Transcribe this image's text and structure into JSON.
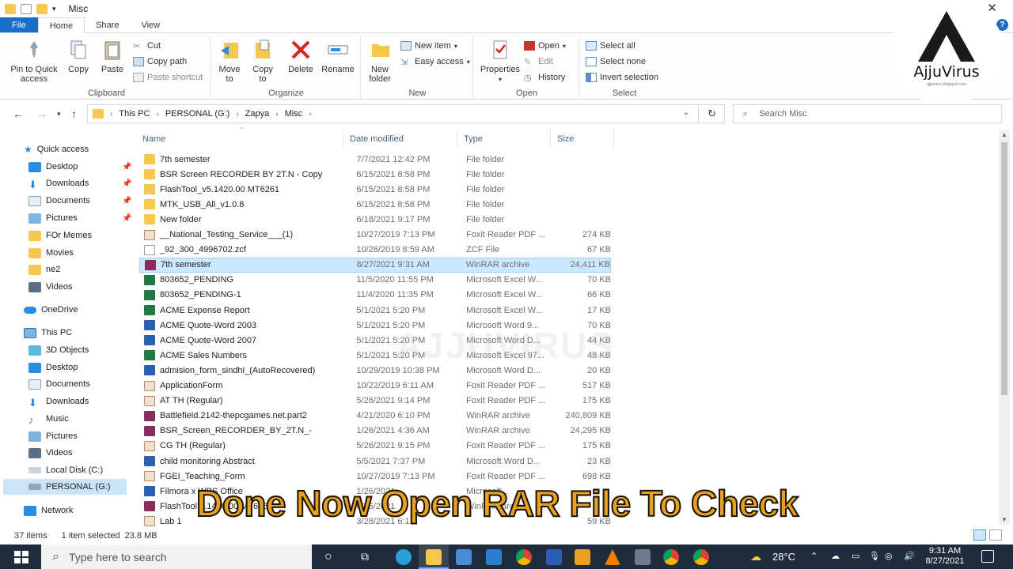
{
  "window": {
    "title": "Misc"
  },
  "ribbon_tabs": [
    "File",
    "Home",
    "Share",
    "View"
  ],
  "ribbon": {
    "clipboard": {
      "label": "Clipboard",
      "pin": "Pin to Quick access",
      "copy": "Copy",
      "paste": "Paste",
      "cut": "Cut",
      "copy_path": "Copy path",
      "paste_shortcut": "Paste shortcut"
    },
    "organize": {
      "label": "Organize",
      "move_to": "Move to",
      "copy_to": "Copy to",
      "delete": "Delete",
      "rename": "Rename"
    },
    "new": {
      "label": "New",
      "new_folder": "New folder",
      "new_item": "New item",
      "easy_access": "Easy access"
    },
    "open": {
      "label": "Open",
      "properties": "Properties",
      "open": "Open",
      "edit": "Edit",
      "history": "History"
    },
    "select": {
      "label": "Select",
      "select_all": "Select all",
      "select_none": "Select none",
      "invert": "Invert selection"
    }
  },
  "address": {
    "crumbs": [
      "This PC",
      "PERSONAL (G:)",
      "Zapya",
      "Misc"
    ],
    "search_placeholder": "Search Misc"
  },
  "nav": {
    "quick_access": "Quick access",
    "quick_items": [
      "Desktop",
      "Downloads",
      "Documents",
      "Pictures",
      "FOr Memes",
      "Movies",
      "ne2",
      "Videos"
    ],
    "onedrive": "OneDrive",
    "this_pc": "This PC",
    "pc_items": [
      "3D Objects",
      "Desktop",
      "Documents",
      "Downloads",
      "Music",
      "Pictures",
      "Videos",
      "Local Disk (C:)",
      "PERSONAL (G:)"
    ],
    "network": "Network"
  },
  "columns": {
    "name": "Name",
    "date": "Date modified",
    "type": "Type",
    "size": "Size"
  },
  "files": [
    {
      "name": "7th semester",
      "date": "7/7/2021 12:42 PM",
      "type": "File folder",
      "size": "",
      "icon": "folder"
    },
    {
      "name": "BSR Screen RECORDER BY 2T.N - Copy",
      "date": "6/15/2021 8:58 PM",
      "type": "File folder",
      "size": "",
      "icon": "folder"
    },
    {
      "name": "FlashTool_v5.1420.00 MT6261",
      "date": "6/15/2021 8:58 PM",
      "type": "File folder",
      "size": "",
      "icon": "folder"
    },
    {
      "name": "MTK_USB_All_v1.0.8",
      "date": "6/15/2021 8:58 PM",
      "type": "File folder",
      "size": "",
      "icon": "folder"
    },
    {
      "name": "New folder",
      "date": "6/18/2021 9:17 PM",
      "type": "File folder",
      "size": "",
      "icon": "folder"
    },
    {
      "name": "__National_Testing_Service___(1)",
      "date": "10/27/2019 7:13 PM",
      "type": "Foxit Reader PDF ...",
      "size": "274 KB",
      "icon": "pdf"
    },
    {
      "name": "_92_300_4996702.zcf",
      "date": "10/26/2019 8:59 AM",
      "type": "ZCF File",
      "size": "67 KB",
      "icon": "file"
    },
    {
      "name": "7th semester",
      "date": "8/27/2021 9:31 AM",
      "type": "WinRAR archive",
      "size": "24,411 KB",
      "icon": "rar",
      "selected": true
    },
    {
      "name": "803652_PENDING",
      "date": "11/5/2020 11:55 PM",
      "type": "Microsoft Excel W...",
      "size": "70 KB",
      "icon": "excel"
    },
    {
      "name": "803652_PENDING-1",
      "date": "11/4/2020 11:35 PM",
      "type": "Microsoft Excel W...",
      "size": "66 KB",
      "icon": "excel"
    },
    {
      "name": "ACME Expense Report",
      "date": "5/1/2021 5:20 PM",
      "type": "Microsoft Excel W...",
      "size": "17 KB",
      "icon": "excel"
    },
    {
      "name": "ACME Quote-Word 2003",
      "date": "5/1/2021 5:20 PM",
      "type": "Microsoft Word 9...",
      "size": "70 KB",
      "icon": "word"
    },
    {
      "name": "ACME Quote-Word 2007",
      "date": "5/1/2021 5:20 PM",
      "type": "Microsoft Word D...",
      "size": "44 KB",
      "icon": "word"
    },
    {
      "name": "ACME Sales Numbers",
      "date": "5/1/2021 5:20 PM",
      "type": "Microsoft Excel 97...",
      "size": "48 KB",
      "icon": "excel"
    },
    {
      "name": "admision_form_sindhi_(AutoRecovered)",
      "date": "10/29/2019 10:38 PM",
      "type": "Microsoft Word D...",
      "size": "20 KB",
      "icon": "word"
    },
    {
      "name": "ApplicationForm",
      "date": "10/22/2019 6:11 AM",
      "type": "Foxit Reader PDF ...",
      "size": "517 KB",
      "icon": "pdf"
    },
    {
      "name": "AT TH (Regular)",
      "date": "5/26/2021 9:14 PM",
      "type": "Foxit Reader PDF ...",
      "size": "175 KB",
      "icon": "pdf"
    },
    {
      "name": "Battlefield.2142-thepcgames.net.part2",
      "date": "4/21/2020 6:10 PM",
      "type": "WinRAR archive",
      "size": "240,809 KB",
      "icon": "rar"
    },
    {
      "name": "BSR_Screen_RECORDER_BY_2T.N_-",
      "date": "1/26/2021 4:36 AM",
      "type": "WinRAR archive",
      "size": "24,295 KB",
      "icon": "rar"
    },
    {
      "name": "CG TH (Regular)",
      "date": "5/26/2021 9:15 PM",
      "type": "Foxit Reader PDF ...",
      "size": "175 KB",
      "icon": "pdf"
    },
    {
      "name": "child monitoring Abstract",
      "date": "5/5/2021 7:37 PM",
      "type": "Microsoft Word D...",
      "size": "23 KB",
      "icon": "word"
    },
    {
      "name": "FGEI_Teaching_Form",
      "date": "10/27/2019 7:13 PM",
      "type": "Foxit Reader PDF ...",
      "size": "698 KB",
      "icon": "pdf"
    },
    {
      "name": "Filmora x WPS Office",
      "date": "1/26/2021",
      "type": "Microsoft...",
      "size": "",
      "icon": "word"
    },
    {
      "name": "FlashTool 5.1420.00 MT6261",
      "date": "6/15/2021",
      "type": "WinRAR archive",
      "size": "",
      "icon": "rar"
    },
    {
      "name": "Lab 1",
      "date": "3/28/2021 6:1",
      "type": "",
      "size": "59 KB",
      "icon": "pdf"
    }
  ],
  "status": {
    "count": "37 items",
    "selected": "1 item selected  23.8 MB"
  },
  "caption": "Done Now Open RAR File To Check",
  "watermark": "AJJUVIRUS",
  "logo": {
    "brand": "AjjuVirus",
    "sub": "ajjuvirus.blogspot.com"
  },
  "taskbar": {
    "search_placeholder": "Type here to search",
    "temp": "28°C",
    "time": "9:31 AM",
    "date": "8/27/2021"
  },
  "colors": {
    "accent": "#1a6ec7",
    "selection": "#cce8ff",
    "caption": "#e8a020",
    "folder": "#f5c74d",
    "taskbar": "#1f2c3b"
  }
}
